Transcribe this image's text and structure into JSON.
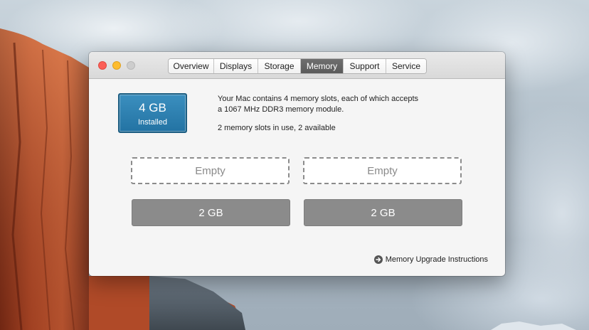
{
  "window": {
    "tabs": [
      {
        "label": "Overview"
      },
      {
        "label": "Displays"
      },
      {
        "label": "Storage"
      },
      {
        "label": "Memory",
        "active": true
      },
      {
        "label": "Support"
      },
      {
        "label": "Service"
      }
    ]
  },
  "memory": {
    "installed_size": "4 GB",
    "installed_label": "Installed",
    "description_line1": "Your Mac contains 4 memory slots, each of which accepts",
    "description_line2": "a 1067 MHz DDR3 memory module.",
    "slots_summary": "2 memory slots in use, 2 available",
    "slots": [
      {
        "label": "Empty",
        "state": "empty"
      },
      {
        "label": "Empty",
        "state": "empty"
      },
      {
        "label": "2 GB",
        "state": "filled"
      },
      {
        "label": "2 GB",
        "state": "filled"
      }
    ],
    "upgrade_link": "Memory Upgrade Instructions"
  },
  "icons": {
    "upgrade_link_icon": "arrow-circle-right-icon"
  },
  "colors": {
    "badge_blue": "#2a7aaa",
    "active_tab": "#626262",
    "filled_slot": "#8b8b8b"
  }
}
